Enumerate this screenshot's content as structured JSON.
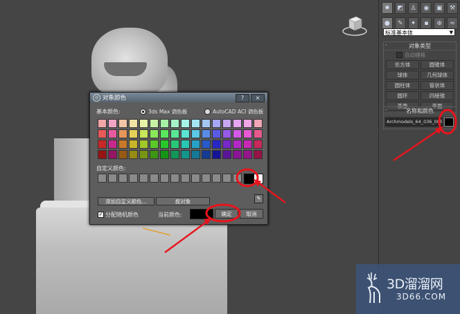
{
  "colors": {
    "annotation_red": "#e8141c",
    "viewport_bg": "#454545",
    "selected_color": "#000000"
  },
  "panel": {
    "tabs": [
      "create-icon",
      "modify-icon",
      "hierarchy-icon",
      "motion-icon",
      "display-icon",
      "utilities-icon"
    ],
    "subtabs": [
      "geometry-icon",
      "shapes-icon",
      "lights-icon",
      "cameras-icon",
      "helpers-icon",
      "spacewarps-icon",
      "systems-icon"
    ],
    "dropdown_value": "标准基本体",
    "object_type": {
      "header": "对象类型",
      "autogrid": "自动栅格",
      "buttons": [
        "长方体",
        "圆锥体",
        "球体",
        "几何球体",
        "圆柱体",
        "管状体",
        "圆环",
        "四棱锥",
        "茶壶",
        "平面"
      ]
    },
    "name_color": {
      "header": "名称和颜色",
      "name_value": "Archmodels_64_036_005"
    }
  },
  "dialog": {
    "title": "对象颜色",
    "help_btn": "?",
    "close_btn": "×",
    "basic_colors_label": "基本颜色:",
    "radio_3dsmax": "3ds Max 调色板",
    "radio_autocad": "AutoCAD ACI 调色板",
    "custom_colors_label": "自定义颜色:",
    "add_custom_btn": "添加自定义颜色...",
    "by_object_btn": "按对象",
    "random_label": "分配随机颜色",
    "current_color_label": "当前颜色:",
    "ok_btn": "确定",
    "cancel_btn": "取消",
    "palette": [
      [
        "#f2a6a6",
        "#f2a6c6",
        "#f2c6a6",
        "#f2e2a6",
        "#e6f2a6",
        "#c6f2a6",
        "#a6f2a6",
        "#a6f2c6",
        "#a6f2e6",
        "#a6e6f2",
        "#a6c6f2",
        "#a6a6f2",
        "#c6a6f2",
        "#e6a6f2",
        "#f2a6e6",
        "#f2a6b6"
      ],
      [
        "#e65a5a",
        "#e65aa0",
        "#e6965a",
        "#e6d25a",
        "#c8e65a",
        "#8ce65a",
        "#5ae65a",
        "#5ae696",
        "#5ae6d2",
        "#5ac8e6",
        "#5a8ce6",
        "#5a5ae6",
        "#965ae6",
        "#d25ae6",
        "#e65ad2",
        "#e65a8c"
      ],
      [
        "#c82828",
        "#c8288c",
        "#c87828",
        "#c8b428",
        "#a0c828",
        "#5ac828",
        "#28c828",
        "#28c878",
        "#28c8b4",
        "#28a0c8",
        "#285ac8",
        "#2828c8",
        "#7828c8",
        "#b428c8",
        "#c828b4",
        "#c8285a"
      ],
      [
        "#961414",
        "#961464",
        "#965a14",
        "#968c14",
        "#789614",
        "#3c9614",
        "#149614",
        "#14965a",
        "#14968c",
        "#147896",
        "#143c96",
        "#141496",
        "#5a1496",
        "#8c1496",
        "#96148c",
        "#961446"
      ]
    ],
    "custom_count": 14
  },
  "watermark": {
    "line1": "3D溜溜网",
    "line2": "3D66.COM"
  }
}
